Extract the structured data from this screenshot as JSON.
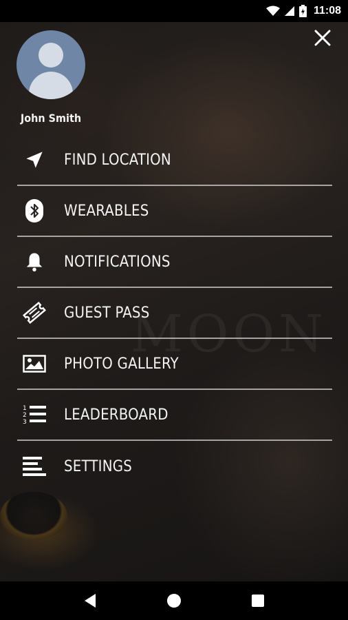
{
  "status_bar": {
    "time": "11:08",
    "icons": [
      "wifi-icon",
      "signal-icon",
      "battery-icon"
    ]
  },
  "drawer": {
    "close_icon": "close-icon",
    "user": {
      "name": "John Smith",
      "avatar_icon": "person-icon"
    },
    "items": [
      {
        "id": "find-location",
        "label": "FIND LOCATION",
        "icon": "navigation-arrow-icon"
      },
      {
        "id": "wearables",
        "label": "WEARABLES",
        "icon": "bluetooth-icon"
      },
      {
        "id": "notifications",
        "label": "NOTIFICATIONS",
        "icon": "bell-icon"
      },
      {
        "id": "guest-pass",
        "label": "GUEST PASS",
        "icon": "ticket-icon"
      },
      {
        "id": "photo-gallery",
        "label": "PHOTO GALLERY",
        "icon": "image-icon"
      },
      {
        "id": "leaderboard",
        "label": "LEADERBOARD",
        "icon": "numbered-list-icon"
      },
      {
        "id": "settings",
        "label": "SETTINGS",
        "icon": "lines-icon"
      }
    ]
  },
  "background": {
    "watermark": "MOON"
  },
  "nav_bar": {
    "buttons": [
      "back-icon",
      "home-icon",
      "recents-icon"
    ]
  }
}
